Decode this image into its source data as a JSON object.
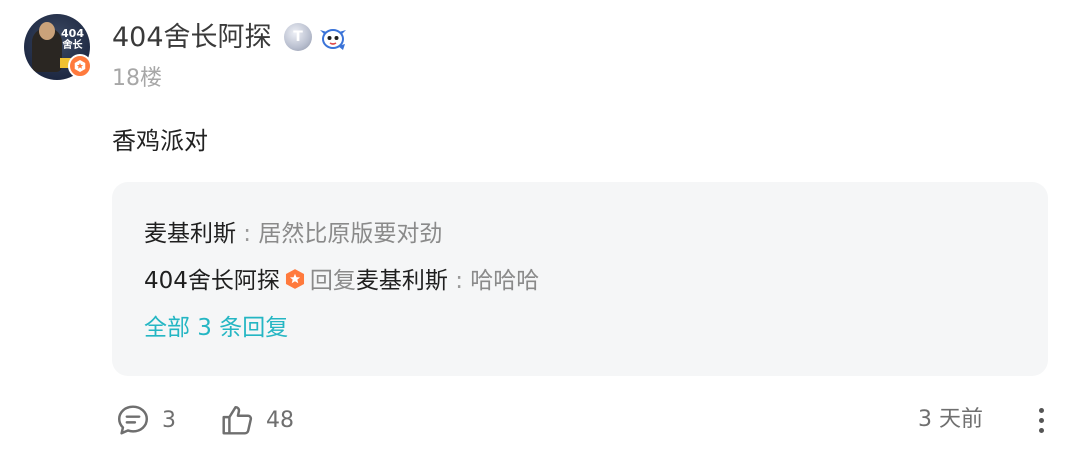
{
  "post": {
    "author": {
      "name": "404舍长阿探",
      "avatar_text_1": "404",
      "avatar_text_2": "舍长",
      "level_badge": "T",
      "badge_color": "#ff7a3d"
    },
    "floor": "18楼",
    "content": "香鸡派对",
    "replies": [
      {
        "user": "麦基利斯",
        "separator": " : ",
        "text": "居然比原版要对劲"
      },
      {
        "user": "404舍长阿探",
        "has_badge": true,
        "reply_word": "回复",
        "target": "麦基利斯",
        "separator": " : ",
        "text": "哈哈哈"
      }
    ],
    "view_all_label": "全部 3 条回复",
    "actions": {
      "comment_count": "3",
      "like_count": "48",
      "comment_icon": "comment-icon",
      "like_icon": "thumbs-up-icon",
      "more_icon": "more-vertical-icon"
    },
    "timestamp": "3 天前"
  },
  "colors": {
    "accent": "#24b6c3",
    "reply_bg": "#f5f6f7",
    "badge": "#ff7a3d"
  }
}
